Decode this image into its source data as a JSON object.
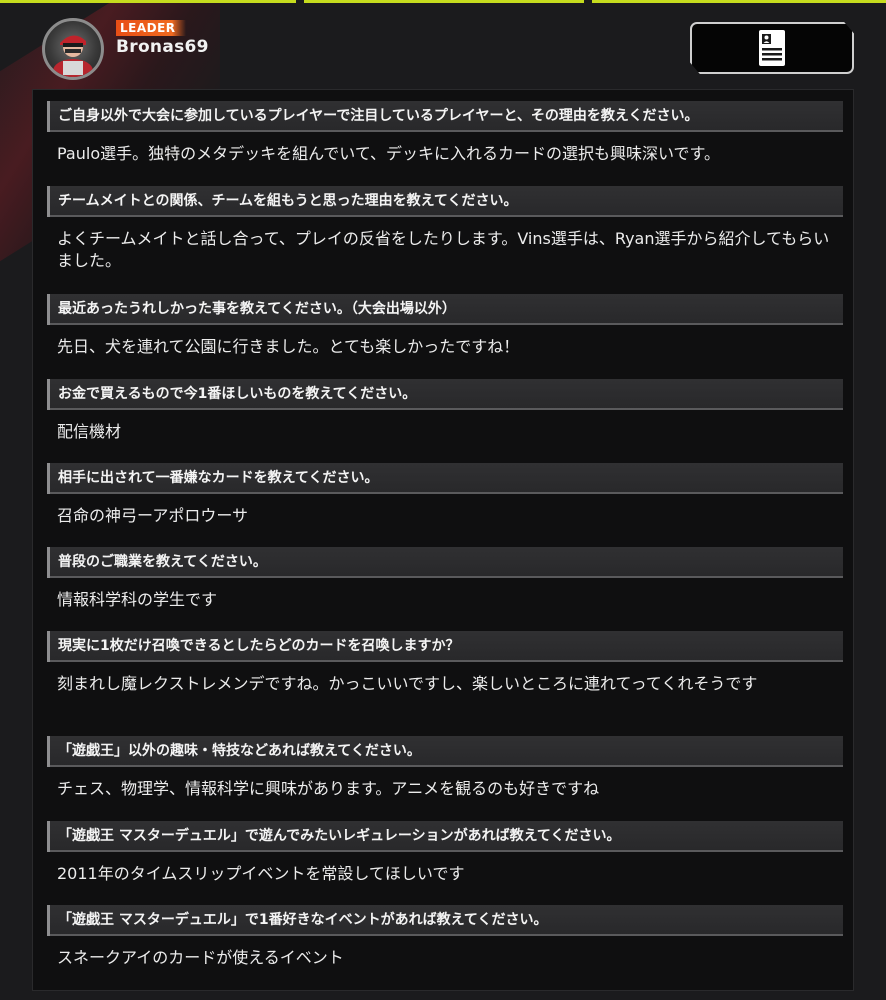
{
  "header": {
    "badge": "LEADER",
    "player_name": "Bronas69",
    "avatar_icon": "player-avatar",
    "profile_button_icon": "profile-card-icon"
  },
  "qa": [
    {
      "question": "ご自身以外で大会に参加しているプレイヤーで注目しているプレイヤーと、その理由を教えください。",
      "answer": "Paulo選手。独特のメタデッキを組んでいて、デッキに入れるカードの選択も興味深いです。"
    },
    {
      "question": "チームメイトとの関係、チームを組もうと思った理由を教えてください。",
      "answer": "よくチームメイトと話し合って、プレイの反省をしたりします。Vins選手は、Ryan選手から紹介してもらいました。"
    },
    {
      "question": "最近あったうれしかった事を教えてください。（大会出場以外）",
      "answer": "先日、犬を連れて公園に行きました。とても楽しかったですね！"
    },
    {
      "question": "お金で買えるもので今1番ほしいものを教えてください。",
      "answer": "配信機材"
    },
    {
      "question": "相手に出されて一番嫌なカードを教えてください。",
      "answer": "召命の神弓ーアポロウーサ"
    },
    {
      "question": "普段のご職業を教えてください。",
      "answer": "情報科学科の学生です"
    },
    {
      "question": "現実に1枚だけ召喚できるとしたらどのカードを召喚しますか？",
      "answer": "刻まれし魔レクストレメンデですね。かっこいいですし、楽しいところに連れてってくれそうです"
    },
    {
      "question": "「遊戯王」以外の趣味・特技などあれば教えてください。",
      "answer": "チェス、物理学、情報科学に興味があります。アニメを観るのも好きですね"
    },
    {
      "question": "「遊戯王 マスターデュエル」で遊んでみたいレギュレーションがあれば教えてください。",
      "answer": "2011年のタイムスリップイベントを常設してほしいです"
    },
    {
      "question": "「遊戯王 マスターデュエル」で1番好きなイベントがあれば教えてください。",
      "answer": "スネークアイのカードが使えるイベント"
    }
  ]
}
